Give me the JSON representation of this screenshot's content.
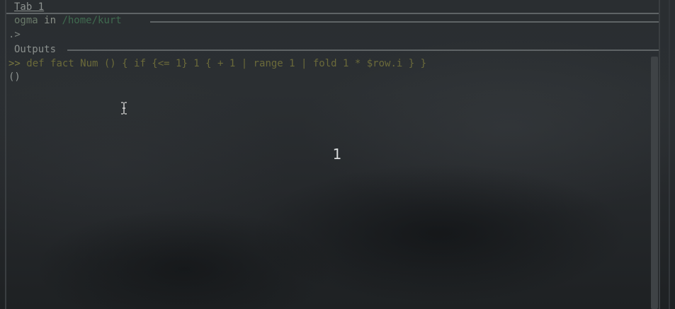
{
  "tab": {
    "label": "Tab 1"
  },
  "prompt": {
    "user": "ogma",
    "in_word": "in",
    "path": "/home/kurt"
  },
  "input": {
    "cursor": ".>"
  },
  "outputs": {
    "heading": "Outputs"
  },
  "history": {
    "prompt_marker": ">>",
    "command": "def fact Num () { if {<= 1} 1 { + 1 | range 1 | fold 1 * $row.i } }",
    "result": "()"
  },
  "display": {
    "value": "1"
  },
  "icons": {
    "mouse_cursor": "text-cursor-icon"
  },
  "colors": {
    "command_text": "#6b6a3a",
    "path_text": "#3f6a4f",
    "rule": "#5f6466"
  }
}
